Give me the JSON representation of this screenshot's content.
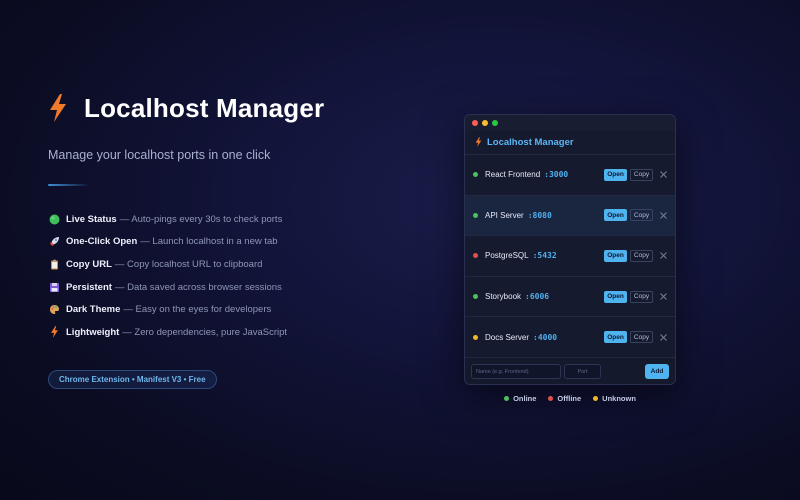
{
  "hero": {
    "title": "Localhost Manager",
    "subtitle": "Manage your localhost ports in one click",
    "features": [
      {
        "icon": "green-circle-icon",
        "name": "Live Status",
        "desc": " — Auto-pings every 30s to check ports"
      },
      {
        "icon": "rocket-icon",
        "name": "One-Click Open",
        "desc": " — Launch localhost in a new tab"
      },
      {
        "icon": "clipboard-icon",
        "name": "Copy URL",
        "desc": " — Copy localhost URL to clipboard"
      },
      {
        "icon": "floppy-disk-icon",
        "name": "Persistent",
        "desc": " — Data saved across browser sessions"
      },
      {
        "icon": "palette-icon",
        "name": "Dark Theme",
        "desc": " — Easy on the eyes for developers"
      },
      {
        "icon": "lightning-bolt-icon",
        "name": "Lightweight",
        "desc": " — Zero dependencies, pure JavaScript"
      }
    ],
    "pill": "Chrome Extension  •  Manifest V3  •  Free"
  },
  "popup": {
    "title": "Localhost Manager",
    "open_label": "Open",
    "copy_label": "Copy",
    "items": [
      {
        "name": "React Frontend",
        "port": ":3000",
        "status": "online"
      },
      {
        "name": "API Server",
        "port": ":8080",
        "status": "online"
      },
      {
        "name": "PostgreSQL",
        "port": ":5432",
        "status": "offline"
      },
      {
        "name": "Storybook",
        "port": ":6006",
        "status": "online"
      },
      {
        "name": "Docs Server",
        "port": ":4000",
        "status": "unknown"
      }
    ],
    "name_placeholder": "Name (e.g. Frontend)",
    "port_placeholder": "Port",
    "add_label": "Add"
  },
  "legend": [
    {
      "label": "Online",
      "color": "#4cc15e"
    },
    {
      "label": "Offline",
      "color": "#e0514d"
    },
    {
      "label": "Unknown",
      "color": "#f0b62c"
    }
  ],
  "colors": {
    "accent": "#4fb3ef",
    "bolt": "#f07a2a",
    "online": "#4cc15e",
    "offline": "#e0514d",
    "unknown": "#f0b62c"
  }
}
